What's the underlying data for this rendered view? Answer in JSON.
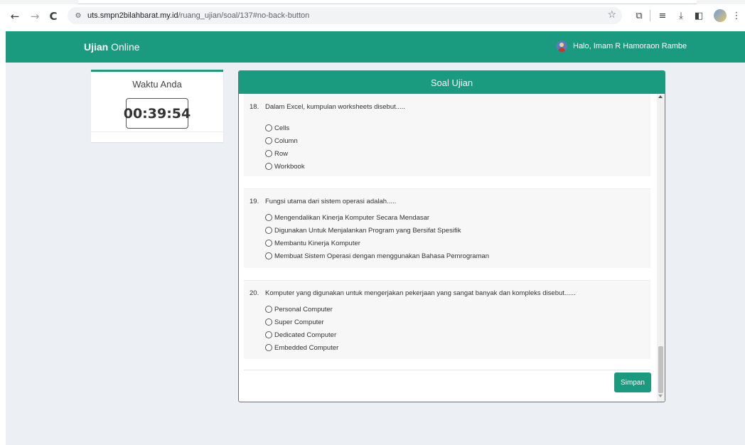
{
  "browser": {
    "url_host": "uts.smpn2bilahbarat.my.id",
    "url_path": "/ruang_ujian/soal/137#no-back-button",
    "back_icon": "arrow-left-icon",
    "forward_icon": "arrow-right-icon",
    "reload_icon": "reload-icon",
    "back_glyph": "←",
    "forward_glyph": "→",
    "reload_glyph": "C",
    "site_glyph": "⚙",
    "star_glyph": "☆",
    "extensions_glyph": "⧉",
    "reading_glyph": "≡",
    "download_glyph": "⤓",
    "sidepanel_glyph": "◧",
    "menu_glyph": "⋮"
  },
  "app": {
    "brand_bold": "Ujian",
    "brand_rest": " Online",
    "user_greeting": "Halo, Imam R Hamoraon Rambe",
    "accent_color": "#1a9a7e"
  },
  "timer": {
    "title": "Waktu Anda",
    "value": "00:39:54"
  },
  "exam": {
    "title": "Soal Ujian",
    "questions": [
      {
        "number": "18.",
        "text": "Dalam Excel, kumpulan worksheets disebut.....",
        "options": [
          "Cells",
          "Column",
          "Row",
          "Workbook"
        ]
      },
      {
        "number": "19.",
        "text": "Fungsi utama dari sistem operasi adalah.....",
        "options": [
          "Mengendalikan Kinerja Komputer Secara Mendasar",
          "Digunakan Untuk Menjalankan Program yang Bersifat Spesifik",
          "Membantu Kinerja Komputer",
          "Membuat Sistem Operasi dengan menggunakan Bahasa Pemrograman"
        ]
      },
      {
        "number": "20.",
        "text": "Komputer yang digunakan untuk mengerjakan pekerjaan yang sangat banyak dan kompleks disebut......",
        "options": [
          "Personal Computer",
          "Super Computer",
          "Dedicated Computer",
          "Embedded Computer"
        ]
      }
    ],
    "save_label": "Simpan"
  }
}
